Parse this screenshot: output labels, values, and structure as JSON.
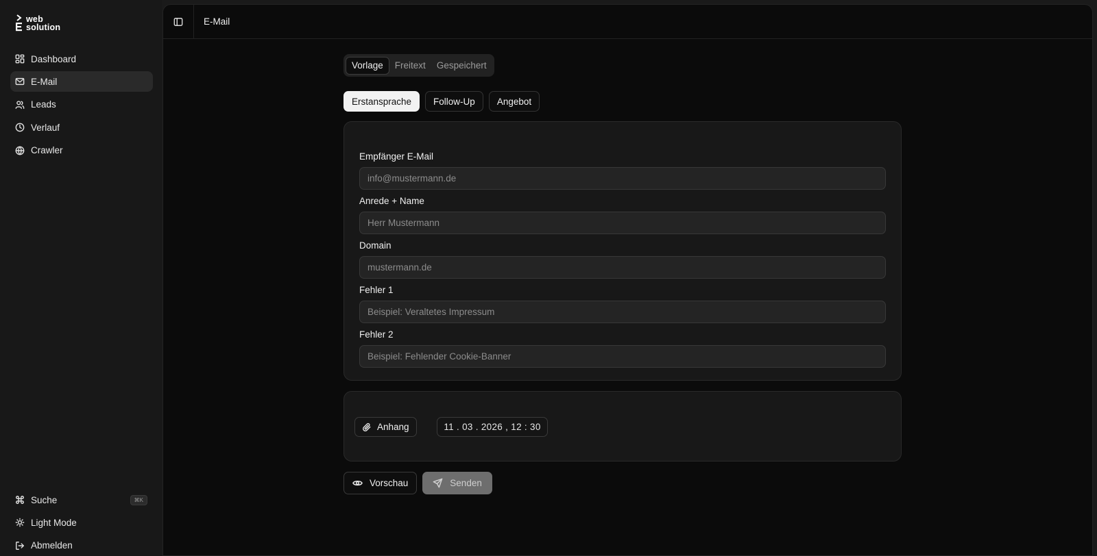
{
  "brand": {
    "line1": "web",
    "line2": "solution"
  },
  "sidebar": {
    "items": [
      {
        "label": "Dashboard",
        "icon": "dashboard-icon"
      },
      {
        "label": "E-Mail",
        "icon": "mail-icon"
      },
      {
        "label": "Leads",
        "icon": "users-icon"
      },
      {
        "label": "Verlauf",
        "icon": "clock-icon"
      },
      {
        "label": "Crawler",
        "icon": "globe-icon"
      }
    ],
    "bottom": [
      {
        "label": "Suche",
        "icon": "command-icon",
        "shortcut": "⌘K"
      },
      {
        "label": "Light Mode",
        "icon": "sun-icon"
      },
      {
        "label": "Abmelden",
        "icon": "logout-icon"
      }
    ]
  },
  "header": {
    "title": "E-Mail"
  },
  "mode_tabs": [
    "Vorlage",
    "Freitext",
    "Gespeichert"
  ],
  "templates": [
    "Erstansprache",
    "Follow-Up",
    "Angebot"
  ],
  "form": {
    "recipient": {
      "label": "Empfänger E-Mail",
      "placeholder": "info@mustermann.de"
    },
    "salutation": {
      "label": "Anrede + Name",
      "placeholder": "Herr Mustermann"
    },
    "domain": {
      "label": "Domain",
      "placeholder": "mustermann.de"
    },
    "error1": {
      "label": "Fehler 1",
      "placeholder": "Beispiel: Veraltetes Impressum"
    },
    "error2": {
      "label": "Fehler 2",
      "placeholder": "Beispiel: Fehlender Cookie-Banner"
    }
  },
  "attachment": {
    "label": "Anhang"
  },
  "schedule": {
    "value": "11 . 03 . 2026 ,  12 : 30"
  },
  "actions": {
    "preview": "Vorschau",
    "send": "Senden"
  }
}
